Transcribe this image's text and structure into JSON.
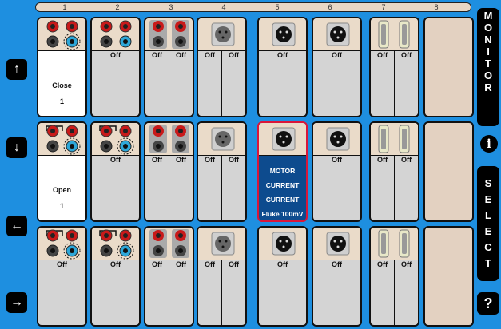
{
  "columns": [
    "1",
    "2",
    "3",
    "4",
    "5",
    "6",
    "7",
    "8"
  ],
  "nav": {
    "up": "↑",
    "down": "↓",
    "left": "←",
    "right": "→"
  },
  "side": {
    "monitor": [
      "M",
      "O",
      "N",
      "I",
      "T",
      "O",
      "R"
    ],
    "select": [
      "S",
      "E",
      "L",
      "E",
      "C",
      "T"
    ],
    "info": "i",
    "help": "?"
  },
  "labels": {
    "off": "Off"
  },
  "row1": {
    "c1_state": "Close",
    "c1_num": "1"
  },
  "row2": {
    "c1_state": "Open",
    "c1_num": "1",
    "c5_lines": [
      "MOTOR",
      "CURRENT",
      "CURRENT",
      "Fluke 100mV"
    ]
  },
  "colors": {
    "background": "#1e8fe0",
    "selected": "#0d4b8e",
    "selected_border": "#d9163a",
    "slot": "#d4d4d4",
    "panel": "#eadbc9"
  }
}
